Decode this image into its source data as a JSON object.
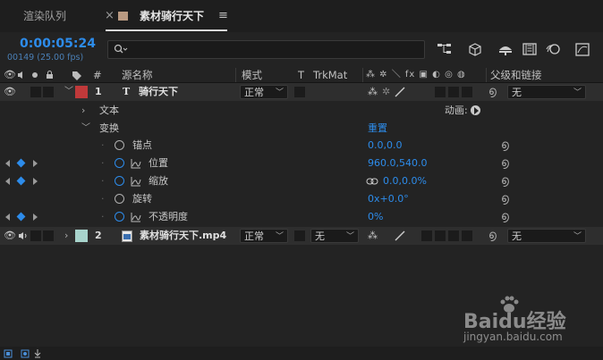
{
  "tabs": [
    {
      "label": "渲染队列"
    },
    {
      "label": "素材骑行天下",
      "close": "×",
      "menu": "≡",
      "color": "#b99a82"
    }
  ],
  "timecode": "0:00:05:24",
  "frame_info": "00149 (25.00 fps)",
  "search": {
    "placeholder": ""
  },
  "headers": {
    "label_col": "#",
    "source_name": "源名称",
    "mode": "模式",
    "t": "T",
    "trkmat": "TrkMat",
    "parent": "父级和链接"
  },
  "layers": [
    {
      "num": "1",
      "name": "骑行天下",
      "type_icon": "T",
      "color": "#c0393a",
      "mode": "正常",
      "parent": "无"
    },
    {
      "num": "2",
      "name": "素材骑行天下.mp4",
      "color": "#a8d4cc",
      "mode": "正常",
      "trkmat": "无",
      "parent": "无"
    }
  ],
  "groups": {
    "text": "文本",
    "animate_label": "动画:",
    "transform": "变换",
    "reset": "重置"
  },
  "properties": [
    {
      "name": "锚点",
      "value": "0.0,0.0"
    },
    {
      "name": "位置",
      "value": "960.0,540.0"
    },
    {
      "name": "缩放",
      "value": "0.0,0.0%"
    },
    {
      "name": "旋转",
      "value": "0x+0.0°"
    },
    {
      "name": "不透明度",
      "value": "0%"
    }
  ],
  "watermark": {
    "brand": "Baidu经验",
    "url": "jingyan.baidu.com"
  },
  "colors": {
    "accent": "#2d8ceb",
    "bg": "#232323",
    "selected_row": "#2e2e2e"
  }
}
